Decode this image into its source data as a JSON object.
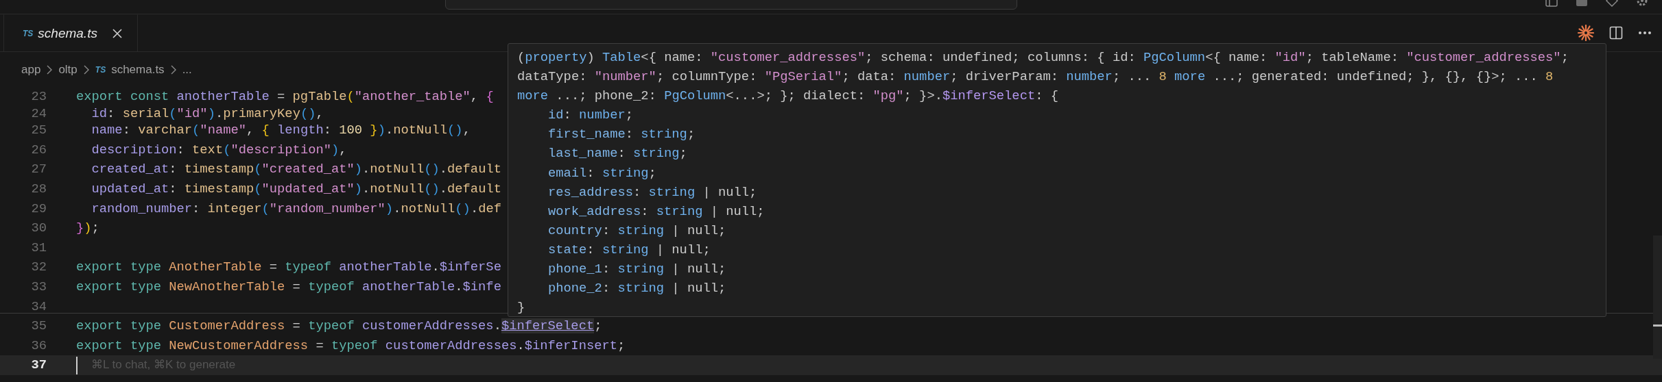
{
  "tab_bar": {
    "tabs": [
      {
        "badge": "TS",
        "label": "schema.ts",
        "selected": true,
        "preview": true
      }
    ]
  },
  "breadcrumbs": [
    {
      "text": "app"
    },
    {
      "text": "oltp"
    },
    {
      "text": "schema.ts",
      "badge": "TS"
    },
    {
      "text": "..."
    }
  ],
  "editor": {
    "sticky_line": {
      "number": "23",
      "tokens": [
        {
          "text": "export const ",
          "kind": "kw"
        },
        {
          "text": "anotherTable",
          "kind": "var"
        },
        {
          "text": " = ",
          "kind": "p"
        },
        {
          "text": "pgTable",
          "kind": "fn"
        },
        {
          "text": "(",
          "kind": "b1"
        },
        {
          "text": "\"another_table\"",
          "kind": "str"
        },
        {
          "text": ", ",
          "kind": "p"
        },
        {
          "text": "{",
          "kind": "b2"
        }
      ]
    },
    "lines": [
      {
        "number": "24",
        "current": false,
        "tokens": [
          {
            "text": "  id",
            "kind": "var"
          },
          {
            "text": ": ",
            "kind": "p"
          },
          {
            "text": "serial",
            "kind": "fn"
          },
          {
            "text": "(",
            "kind": "b3"
          },
          {
            "text": "\"id\"",
            "kind": "str"
          },
          {
            "text": ")",
            "kind": "b3"
          },
          {
            "text": ".",
            "kind": "p"
          },
          {
            "text": "primaryKey",
            "kind": "fn"
          },
          {
            "text": "()",
            "kind": "b3"
          },
          {
            "text": ",",
            "kind": "p"
          }
        ]
      },
      {
        "number": "25",
        "current": false,
        "tokens": [
          {
            "text": "  name",
            "kind": "var"
          },
          {
            "text": ": ",
            "kind": "p"
          },
          {
            "text": "varchar",
            "kind": "fn"
          },
          {
            "text": "(",
            "kind": "b3"
          },
          {
            "text": "\"name\"",
            "kind": "str"
          },
          {
            "text": ", ",
            "kind": "p"
          },
          {
            "text": "{",
            "kind": "b1"
          },
          {
            "text": " length",
            "kind": "var"
          },
          {
            "text": ": ",
            "kind": "p"
          },
          {
            "text": "100",
            "kind": "num"
          },
          {
            "text": " }",
            "kind": "b1"
          },
          {
            "text": ")",
            "kind": "b3"
          },
          {
            "text": ".",
            "kind": "p"
          },
          {
            "text": "notNull",
            "kind": "fn"
          },
          {
            "text": "()",
            "kind": "b3"
          },
          {
            "text": ",",
            "kind": "p"
          }
        ]
      },
      {
        "number": "26",
        "current": false,
        "tokens": [
          {
            "text": "  description",
            "kind": "var"
          },
          {
            "text": ": ",
            "kind": "p"
          },
          {
            "text": "text",
            "kind": "fn"
          },
          {
            "text": "(",
            "kind": "b3"
          },
          {
            "text": "\"description\"",
            "kind": "str"
          },
          {
            "text": ")",
            "kind": "b3"
          },
          {
            "text": ",",
            "kind": "p"
          }
        ]
      },
      {
        "number": "27",
        "current": false,
        "tokens": [
          {
            "text": "  created_at",
            "kind": "var"
          },
          {
            "text": ": ",
            "kind": "p"
          },
          {
            "text": "timestamp",
            "kind": "fn"
          },
          {
            "text": "(",
            "kind": "b3"
          },
          {
            "text": "\"created_at\"",
            "kind": "str"
          },
          {
            "text": ")",
            "kind": "b3"
          },
          {
            "text": ".",
            "kind": "p"
          },
          {
            "text": "notNull",
            "kind": "fn"
          },
          {
            "text": "()",
            "kind": "b3"
          },
          {
            "text": ".",
            "kind": "p"
          },
          {
            "text": "default",
            "kind": "fn"
          }
        ]
      },
      {
        "number": "28",
        "current": false,
        "tokens": [
          {
            "text": "  updated_at",
            "kind": "var"
          },
          {
            "text": ": ",
            "kind": "p"
          },
          {
            "text": "timestamp",
            "kind": "fn"
          },
          {
            "text": "(",
            "kind": "b3"
          },
          {
            "text": "\"updated_at\"",
            "kind": "str"
          },
          {
            "text": ")",
            "kind": "b3"
          },
          {
            "text": ".",
            "kind": "p"
          },
          {
            "text": "notNull",
            "kind": "fn"
          },
          {
            "text": "()",
            "kind": "b3"
          },
          {
            "text": ".",
            "kind": "p"
          },
          {
            "text": "default",
            "kind": "fn"
          }
        ]
      },
      {
        "number": "29",
        "current": false,
        "tokens": [
          {
            "text": "  random_number",
            "kind": "var"
          },
          {
            "text": ": ",
            "kind": "p"
          },
          {
            "text": "integer",
            "kind": "fn"
          },
          {
            "text": "(",
            "kind": "b3"
          },
          {
            "text": "\"random_number\"",
            "kind": "str"
          },
          {
            "text": ")",
            "kind": "b3"
          },
          {
            "text": ".",
            "kind": "p"
          },
          {
            "text": "notNull",
            "kind": "fn"
          },
          {
            "text": "()",
            "kind": "b3"
          },
          {
            "text": ".",
            "kind": "p"
          },
          {
            "text": "def",
            "kind": "fn"
          }
        ]
      },
      {
        "number": "30",
        "current": false,
        "tokens": [
          {
            "text": "}",
            "kind": "b2"
          },
          {
            "text": ")",
            "kind": "b1"
          },
          {
            "text": ";",
            "kind": "p"
          }
        ]
      },
      {
        "number": "31",
        "current": false
      },
      {
        "number": "32",
        "current": false,
        "tokens": [
          {
            "text": "export type ",
            "kind": "kw"
          },
          {
            "text": "AnotherTable",
            "kind": "type"
          },
          {
            "text": " = ",
            "kind": "p"
          },
          {
            "text": "typeof ",
            "kind": "kw"
          },
          {
            "text": "anotherTable",
            "kind": "var"
          },
          {
            "text": ".",
            "kind": "p"
          },
          {
            "text": "$inferSe",
            "kind": "var"
          }
        ]
      },
      {
        "number": "33",
        "current": false,
        "tokens": [
          {
            "text": "export type ",
            "kind": "kw"
          },
          {
            "text": "NewAnotherTable",
            "kind": "type"
          },
          {
            "text": " = ",
            "kind": "p"
          },
          {
            "text": "typeof ",
            "kind": "kw"
          },
          {
            "text": "anotherTable",
            "kind": "var"
          },
          {
            "text": ".",
            "kind": "p"
          },
          {
            "text": "$infe",
            "kind": "var"
          }
        ]
      },
      {
        "number": "34",
        "current": false
      },
      {
        "number": "35",
        "current": false,
        "tokens": [
          {
            "text": "export type ",
            "kind": "kw"
          },
          {
            "text": "CustomerAddress",
            "kind": "type"
          },
          {
            "text": " = ",
            "kind": "p"
          },
          {
            "text": "typeof ",
            "kind": "kw"
          },
          {
            "text": "customerAddresses",
            "kind": "var"
          },
          {
            "text": ".",
            "kind": "p"
          },
          {
            "text": "$inferSelect",
            "kind": "hover"
          },
          {
            "text": ";",
            "kind": "p"
          }
        ]
      },
      {
        "number": "36",
        "current": false,
        "tokens": [
          {
            "text": "export type ",
            "kind": "kw"
          },
          {
            "text": "NewCustomerAddress",
            "kind": "type"
          },
          {
            "text": " = ",
            "kind": "p"
          },
          {
            "text": "typeof ",
            "kind": "kw"
          },
          {
            "text": "customerAddresses",
            "kind": "var"
          },
          {
            "text": ".",
            "kind": "p"
          },
          {
            "text": "$inferInsert",
            "kind": "var"
          },
          {
            "text": ";",
            "kind": "p"
          }
        ]
      },
      {
        "number": "37",
        "current": true,
        "placeholder": "⌘L to chat, ⌘K to generate"
      }
    ]
  },
  "hover": {
    "header": [
      {
        "tokens": [
          {
            "text": "(",
            "kind": "p"
          },
          {
            "text": "property",
            "kind": "type"
          },
          {
            "text": ") ",
            "kind": "p"
          },
          {
            "text": "Table",
            "kind": "type"
          },
          {
            "text": "<{ name: ",
            "kind": "p"
          },
          {
            "text": "\"customer_addresses\"",
            "kind": "str"
          },
          {
            "text": "; schema: undefined; columns: { id: ",
            "kind": "p"
          },
          {
            "text": "PgColumn",
            "kind": "type"
          },
          {
            "text": "<{ name: ",
            "kind": "p"
          },
          {
            "text": "\"id\"",
            "kind": "str"
          },
          {
            "text": "; tableName: ",
            "kind": "p"
          },
          {
            "text": "\"customer_addresses\"",
            "kind": "str"
          },
          {
            "text": ";",
            "kind": "p"
          }
        ]
      },
      {
        "tokens": [
          {
            "text": "dataType: ",
            "kind": "p"
          },
          {
            "text": "\"number\"",
            "kind": "str"
          },
          {
            "text": "; columnType: ",
            "kind": "p"
          },
          {
            "text": "\"PgSerial\"",
            "kind": "str"
          },
          {
            "text": "; data: ",
            "kind": "p"
          },
          {
            "text": "number",
            "kind": "type"
          },
          {
            "text": "; driverParam: ",
            "kind": "p"
          },
          {
            "text": "number",
            "kind": "type"
          },
          {
            "text": "; ... ",
            "kind": "p"
          },
          {
            "text": "8",
            "kind": "num"
          },
          {
            "text": " more",
            "kind": "type"
          },
          {
            "text": " ...; generated: undefined; }, {}, {}>; ... ",
            "kind": "p"
          },
          {
            "text": "8",
            "kind": "num"
          }
        ]
      },
      {
        "tokens": [
          {
            "text": "more",
            "kind": "type"
          },
          {
            "text": " ...; phone_2: ",
            "kind": "p"
          },
          {
            "text": "PgColumn",
            "kind": "type"
          },
          {
            "text": "<...>; }; dialect: ",
            "kind": "p"
          },
          {
            "text": "\"pg\"",
            "kind": "str"
          },
          {
            "text": "; }>.",
            "kind": "p"
          },
          {
            "text": "$inferSelect",
            "kind": "member"
          },
          {
            "text": ": {",
            "kind": "p"
          }
        ]
      }
    ],
    "fields": [
      {
        "tokens": [
          {
            "text": "id",
            "kind": "field"
          },
          {
            "text": ": ",
            "kind": "p"
          },
          {
            "text": "number",
            "kind": "type"
          },
          {
            "text": ";",
            "kind": "p"
          }
        ]
      },
      {
        "tokens": [
          {
            "text": "first_name",
            "kind": "field"
          },
          {
            "text": ": ",
            "kind": "p"
          },
          {
            "text": "string",
            "kind": "type"
          },
          {
            "text": ";",
            "kind": "p"
          }
        ]
      },
      {
        "tokens": [
          {
            "text": "last_name",
            "kind": "field"
          },
          {
            "text": ": ",
            "kind": "p"
          },
          {
            "text": "string",
            "kind": "type"
          },
          {
            "text": ";",
            "kind": "p"
          }
        ]
      },
      {
        "tokens": [
          {
            "text": "email",
            "kind": "field"
          },
          {
            "text": ": ",
            "kind": "p"
          },
          {
            "text": "string",
            "kind": "type"
          },
          {
            "text": ";",
            "kind": "p"
          }
        ]
      },
      {
        "tokens": [
          {
            "text": "res_address",
            "kind": "field"
          },
          {
            "text": ": ",
            "kind": "p"
          },
          {
            "text": "string",
            "kind": "type"
          },
          {
            "text": " | null;",
            "kind": "p"
          }
        ]
      },
      {
        "tokens": [
          {
            "text": "work_address",
            "kind": "field"
          },
          {
            "text": ": ",
            "kind": "p"
          },
          {
            "text": "string",
            "kind": "type"
          },
          {
            "text": " | null;",
            "kind": "p"
          }
        ]
      },
      {
        "tokens": [
          {
            "text": "country",
            "kind": "field"
          },
          {
            "text": ": ",
            "kind": "p"
          },
          {
            "text": "string",
            "kind": "type"
          },
          {
            "text": " | null;",
            "kind": "p"
          }
        ]
      },
      {
        "tokens": [
          {
            "text": "state",
            "kind": "field"
          },
          {
            "text": ": ",
            "kind": "p"
          },
          {
            "text": "string",
            "kind": "type"
          },
          {
            "text": " | null;",
            "kind": "p"
          }
        ]
      },
      {
        "tokens": [
          {
            "text": "phone_1",
            "kind": "field"
          },
          {
            "text": ": ",
            "kind": "p"
          },
          {
            "text": "string",
            "kind": "type"
          },
          {
            "text": " | null;",
            "kind": "p"
          }
        ]
      },
      {
        "tokens": [
          {
            "text": "phone_2",
            "kind": "field"
          },
          {
            "text": ": ",
            "kind": "p"
          },
          {
            "text": "string",
            "kind": "type"
          },
          {
            "text": " | null;",
            "kind": "p"
          }
        ]
      }
    ],
    "footer": "}"
  }
}
